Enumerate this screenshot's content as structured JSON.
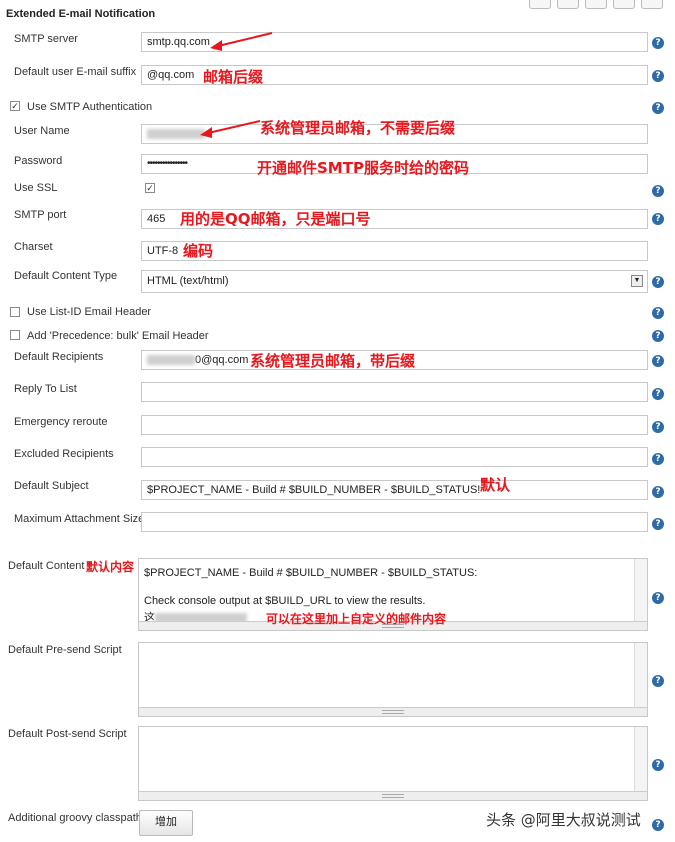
{
  "section_title": "Extended E-mail Notification",
  "fields": {
    "smtp_server": {
      "label": "SMTP server",
      "value": "smtp.qq.com"
    },
    "email_suffix": {
      "label": "Default user E-mail suffix",
      "value": "@qq.com"
    },
    "use_smtp_auth": {
      "label": "Use SMTP Authentication",
      "checked": true
    },
    "user_name": {
      "label": "User Name",
      "value": "***@qq.com"
    },
    "password": {
      "label": "Password",
      "value": "••••••••••••••••"
    },
    "use_ssl": {
      "label": "Use SSL",
      "checked": true
    },
    "smtp_port": {
      "label": "SMTP port",
      "value": "465"
    },
    "charset": {
      "label": "Charset",
      "value": "UTF-8"
    },
    "content_type": {
      "label": "Default Content Type",
      "value": "HTML (text/html)"
    },
    "list_id": {
      "label": "Use List-ID Email Header",
      "checked": false
    },
    "precedence": {
      "label": "Add 'Precedence: bulk' Email Header",
      "checked": false
    },
    "default_recipients": {
      "label": "Default Recipients",
      "value": "0@qq.com"
    },
    "reply_to": {
      "label": "Reply To List",
      "value": ""
    },
    "emergency_reroute": {
      "label": "Emergency reroute",
      "value": ""
    },
    "excluded_recipients": {
      "label": "Excluded Recipients",
      "value": ""
    },
    "default_subject": {
      "label": "Default Subject",
      "value": "$PROJECT_NAME - Build # $BUILD_NUMBER - $BUILD_STATUS!"
    },
    "max_attachment": {
      "label": "Maximum Attachment Size",
      "value": ""
    },
    "default_content": {
      "label": "Default Content",
      "line1": "$PROJECT_NAME - Build # $BUILD_NUMBER - $BUILD_STATUS:",
      "line2": "Check console output at $BUILD_URL to view the results.",
      "line3_prefix": "这"
    },
    "presend_script": {
      "label": "Default Pre-send Script"
    },
    "postsend_script": {
      "label": "Default Post-send Script"
    },
    "groovy_classpath": {
      "label": "Additional groovy classpath",
      "button": "增加"
    }
  },
  "annotations": {
    "suffix": "邮箱后缀",
    "username": "系统管理员邮箱，不需要后缀",
    "password": "开通邮件SMTP服务时给的密码",
    "port": "用的是QQ邮箱，只是端口号",
    "charset": "编码",
    "recipients": "系统管理员邮箱，带后缀",
    "subject": "默认",
    "content": "默认内容",
    "content_custom": "可以在这里加上自定义的邮件内容"
  },
  "watermark": "头条 @阿里大叔说测试",
  "help_glyph": "?",
  "check_glyph": "✓",
  "colors": {
    "annotation": "#e8171d",
    "help": "#2f6aa8"
  }
}
